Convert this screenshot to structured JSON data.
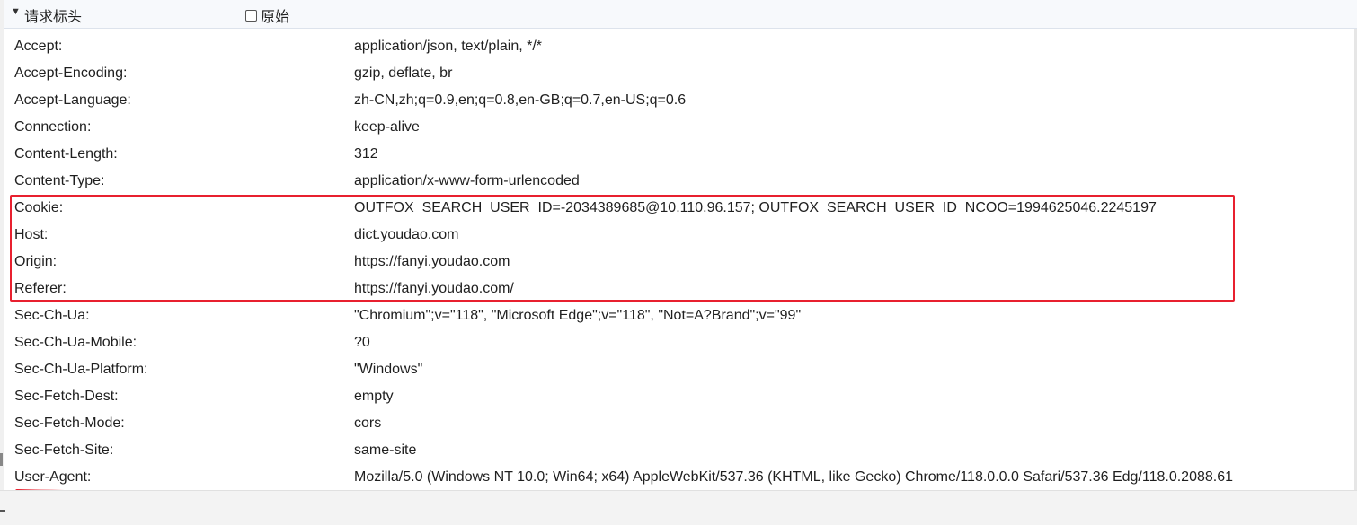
{
  "section": {
    "toggle_glyph": "▼",
    "title": "请求标头",
    "raw_label": "原始",
    "raw_checked": false
  },
  "headers": [
    {
      "name": "Accept:",
      "value": "application/json, text/plain, */*"
    },
    {
      "name": "Accept-Encoding:",
      "value": "gzip, deflate, br"
    },
    {
      "name": "Accept-Language:",
      "value": "zh-CN,zh;q=0.9,en;q=0.8,en-GB;q=0.7,en-US;q=0.6"
    },
    {
      "name": "Connection:",
      "value": "keep-alive"
    },
    {
      "name": "Content-Length:",
      "value": "312"
    },
    {
      "name": "Content-Type:",
      "value": "application/x-www-form-urlencoded"
    },
    {
      "name": "Cookie:",
      "value": "OUTFOX_SEARCH_USER_ID=-2034389685@10.110.96.157; OUTFOX_SEARCH_USER_ID_NCOO=1994625046.2245197"
    },
    {
      "name": "Host:",
      "value": "dict.youdao.com"
    },
    {
      "name": "Origin:",
      "value": "https://fanyi.youdao.com"
    },
    {
      "name": "Referer:",
      "value": "https://fanyi.youdao.com/"
    },
    {
      "name": "Sec-Ch-Ua:",
      "value": "\"Chromium\";v=\"118\", \"Microsoft Edge\";v=\"118\", \"Not=A?Brand\";v=\"99\""
    },
    {
      "name": "Sec-Ch-Ua-Mobile:",
      "value": "?0"
    },
    {
      "name": "Sec-Ch-Ua-Platform:",
      "value": "\"Windows\""
    },
    {
      "name": "Sec-Fetch-Dest:",
      "value": "empty"
    },
    {
      "name": "Sec-Fetch-Mode:",
      "value": "cors"
    },
    {
      "name": "Sec-Fetch-Site:",
      "value": "same-site"
    },
    {
      "name": "User-Agent:",
      "value": "Mozilla/5.0 (Windows NT 10.0; Win64; x64) AppleWebKit/537.36 (KHTML, like Gecko) Chrome/118.0.0.0 Safari/537.36 Edg/118.0.2088.61"
    }
  ],
  "annotations": {
    "highlight_color": "#e8202f",
    "highlight_rows": [
      "Cookie:",
      "Host:",
      "Origin:",
      "Referer:"
    ],
    "underlined_row": "User-Agent:"
  }
}
